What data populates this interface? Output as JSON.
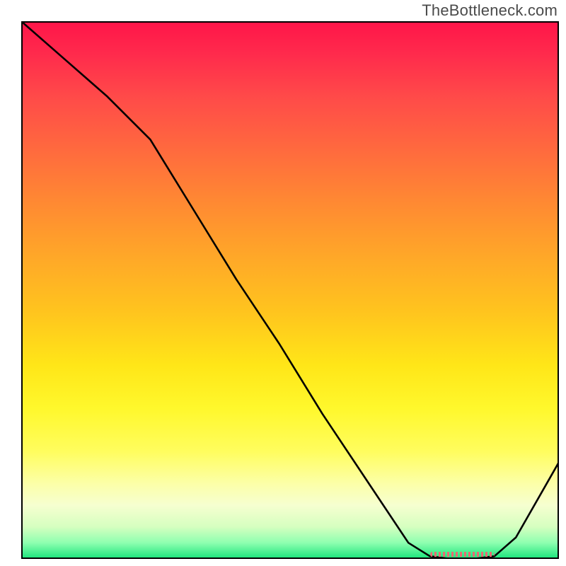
{
  "watermark": "TheBottleneck.com",
  "chart_data": {
    "type": "line",
    "title": "",
    "xlabel": "",
    "ylabel": "",
    "xlim": [
      0,
      100
    ],
    "ylim": [
      0,
      100
    ],
    "x": [
      0,
      8,
      16,
      24,
      32,
      40,
      48,
      56,
      64,
      72,
      76,
      80,
      84,
      88,
      92,
      100
    ],
    "values": [
      100,
      93,
      86,
      78,
      65,
      52,
      40,
      27,
      15,
      3,
      0.5,
      0,
      0,
      0.5,
      4,
      18
    ],
    "optimal_zone": {
      "x_start": 76,
      "x_end": 88
    },
    "gradient_stops": [
      {
        "pos": 0,
        "color": "#ff1549"
      },
      {
        "pos": 50,
        "color": "#ffc41e"
      },
      {
        "pos": 85,
        "color": "#fcffa8"
      },
      {
        "pos": 100,
        "color": "#18e47a"
      }
    ],
    "legend": [],
    "grid": false
  }
}
